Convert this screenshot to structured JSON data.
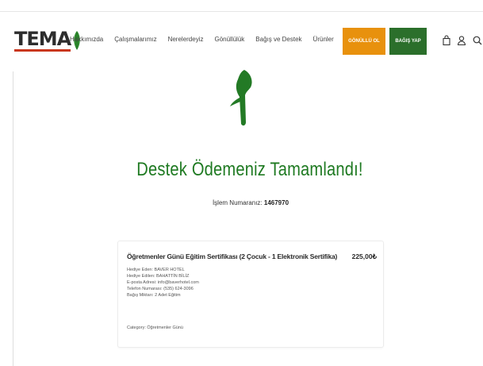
{
  "brand": {
    "logo_text": "TEMA"
  },
  "nav": {
    "links": [
      "Hakkımızda",
      "Çalışmalarımız",
      "Nerelerdeyiz",
      "Gönüllülük",
      "Bağış ve Destek",
      "Ürünler"
    ],
    "volunteer_button": "GÖNÜLLÜ OL",
    "donate_button": "BAĞIŞ YAP"
  },
  "confirmation": {
    "title": "Destek Ödemeniz Tamamlandı!",
    "transaction_label": "İşlem Numaranız:",
    "transaction_number": "1467970"
  },
  "order": {
    "product_title": "Öğretmenler Günü Eğitim Sertifikası (2 Çocuk - 1 Elektronik Sertifika)",
    "price": "225,00₺",
    "details": [
      "Hediye Eden: BAVER HOTEL",
      "Hediye Edilen: BAHATTİN BİLİZ",
      "E-posta Adresi: info@baverhotel.com",
      "Telefon Numarası: (535) 624-3096",
      "Bağış Miktarı: 2 Adet Eğitim"
    ],
    "category": "Category: Öğretmenler Günü"
  },
  "colors": {
    "brand_green": "#1f7a22",
    "volunteer_orange": "#e8910d",
    "donate_green": "#2b6f2b",
    "logo_underline_red": "#c9371d"
  },
  "icons": [
    "bag-icon",
    "user-icon",
    "search-icon"
  ]
}
